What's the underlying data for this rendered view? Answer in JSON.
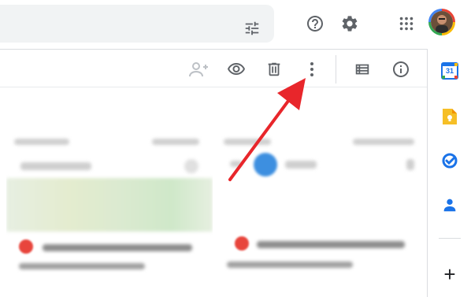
{
  "colors": {
    "arrow": "#e8262b",
    "icon_gray": "#5f6368",
    "disabled_gray": "#bdc1c6",
    "calendar_blue": "#1a73e8",
    "keep_yellow": "#f6bf26",
    "tasks_blue": "#1a73e8",
    "contacts_blue": "#1a73e8"
  },
  "header": {
    "search_icon": "tune-icon",
    "icons": [
      "help-icon",
      "settings-icon",
      "apps-grid-icon"
    ],
    "avatar": "account-avatar"
  },
  "toolbar": {
    "icons": [
      "add-person-icon",
      "eye-icon",
      "trash-icon",
      "more-vert-icon",
      "list-view-icon",
      "info-icon"
    ]
  },
  "side_panel": {
    "apps": [
      "calendar-icon",
      "keep-icon",
      "tasks-icon",
      "contacts-icon"
    ],
    "calendar_day": "31",
    "add_label": "+"
  }
}
